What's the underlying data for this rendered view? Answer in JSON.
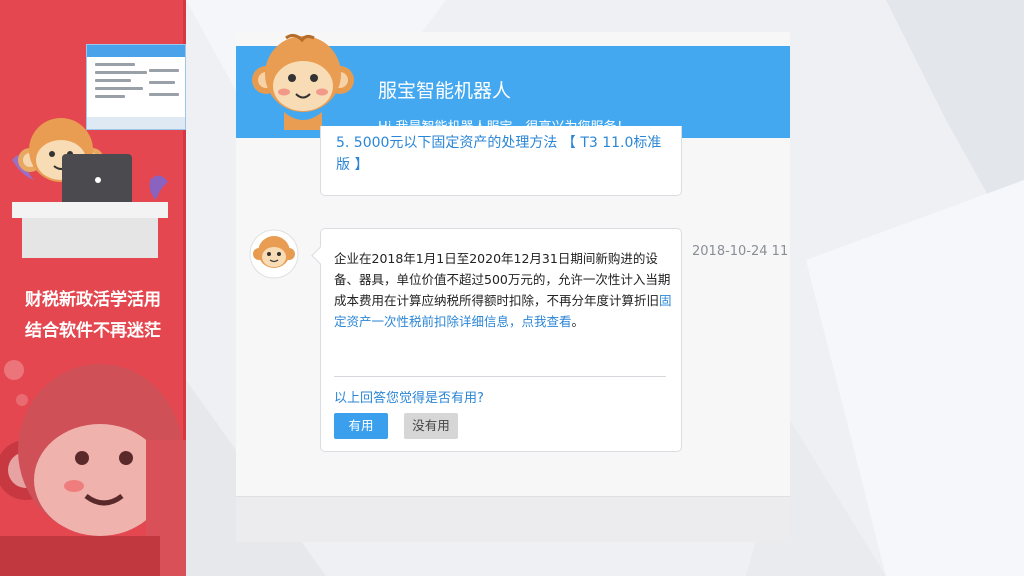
{
  "colors": {
    "accent": "#44a8f0",
    "left_panel": "#e4474f",
    "link": "#2b86d6"
  },
  "left_panel": {
    "slogan_line1": "财税新政活学活用",
    "slogan_line2": "结合软件不再迷茫"
  },
  "chat": {
    "title": "服宝智能机器人",
    "subtitle": "Hi 我是智能机器人服宝，很高兴为您服务！",
    "previous_link": "5. 5000元以下固定资产的处理方法 【 T3 11.0标准版 】",
    "answer_text": "企业在2018年1月1日至2020年12月31日期间新购进的设备、器具，单位价值不超过500万元的，允许一次性计入当期成本费用在计算应纳税所得额时扣除，不再分年度计算折旧",
    "answer_link": "固定资产一次性税前扣除详细信息，点我查看",
    "answer_end": "。",
    "timestamp": "2018-10-24 11",
    "feedback_question": "以上回答您觉得是否有用?",
    "yes_label": "有用",
    "no_label": "没有用"
  }
}
